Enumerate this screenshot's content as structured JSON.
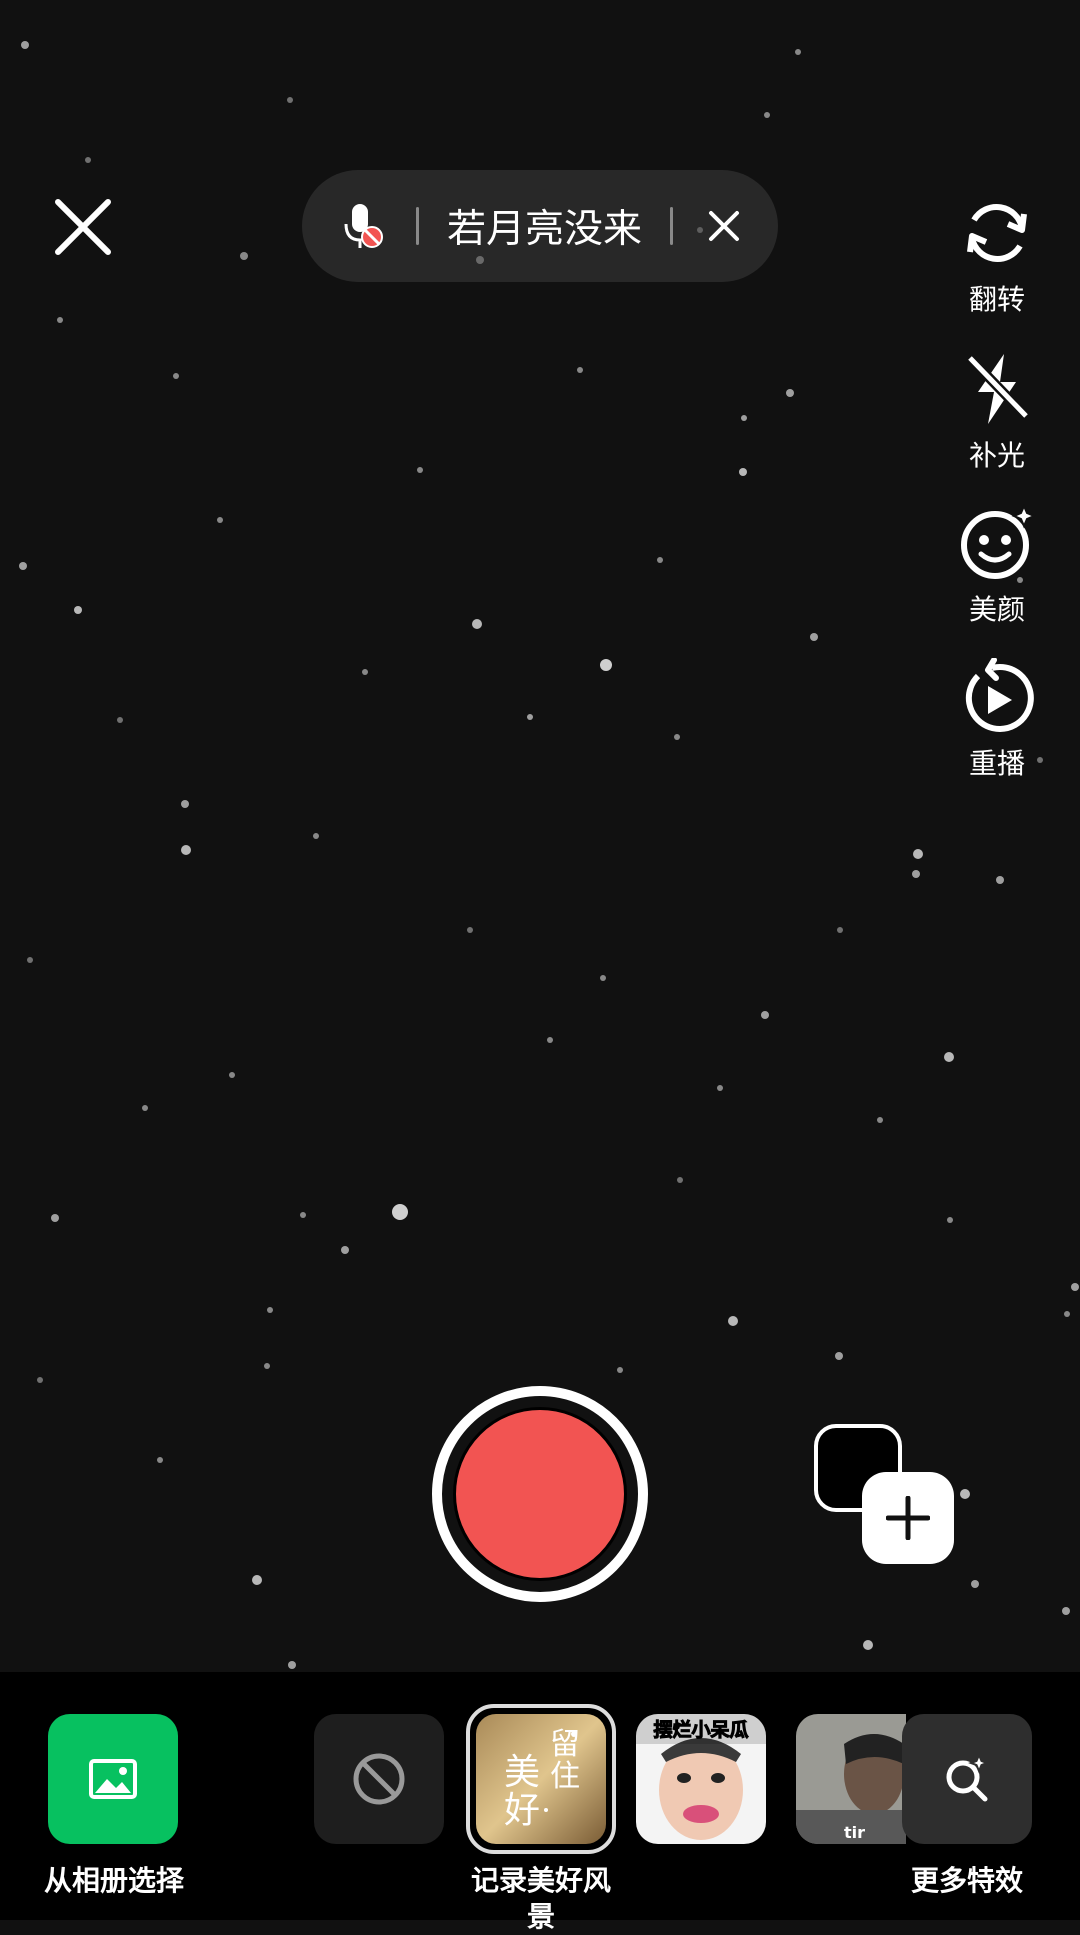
{
  "music": {
    "title": "若月亮没来"
  },
  "side_tools": [
    {
      "label": "翻转",
      "icon": "flip-camera-icon"
    },
    {
      "label": "补光",
      "icon": "fill-light-off-icon"
    },
    {
      "label": "美颜",
      "icon": "beauty-face-icon"
    },
    {
      "label": "重播",
      "icon": "replay-icon"
    }
  ],
  "bottom": {
    "album_label": "从相册选择",
    "selected_effect_label": "记录美好风景",
    "more_label": "更多特效"
  },
  "effects": [
    {
      "name": "no-effect"
    },
    {
      "name": "留住美好",
      "text": [
        "留",
        "住",
        "美",
        "好"
      ]
    },
    {
      "name": "摆烂小呆瓜",
      "text": "摆烂小呆瓜"
    },
    {
      "name": "boy-effect",
      "text": "tir"
    }
  ],
  "colors": {
    "record": "#f25452",
    "album": "#07c160",
    "background": "#111111"
  }
}
